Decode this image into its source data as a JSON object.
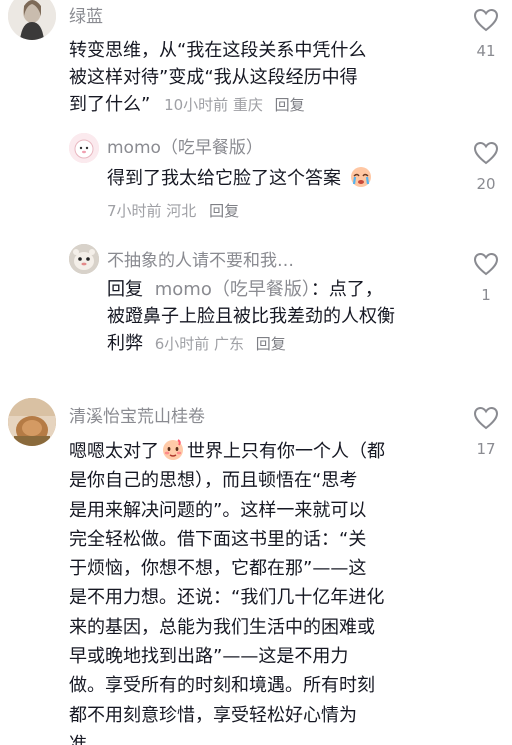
{
  "comments": [
    {
      "author": "绿蓝",
      "lines": [
        "转变思维，从“我在这段关系中凭什么",
        "被这样对待”变成“我从这段经历中得",
        "到了什么”"
      ],
      "meta": "10小时前 重庆",
      "reply_label": "回复",
      "likes": "41",
      "replies": [
        {
          "author": "momo（吃早餐版）",
          "text": "得到了我太给它脸了这个答案",
          "meta": "7小时前 河北",
          "reply_label": "回复",
          "likes": "20"
        },
        {
          "author": "不抽象的人请不要和我…",
          "prefix": "回复",
          "reply_to": "momo（吃早餐版）",
          "line1_rest": "：点了，",
          "line2": "被蹬鼻子上脸且被比我差劲的人权衡",
          "line3": "利弊",
          "meta": "6小时前 广东",
          "reply_label": "回复",
          "likes": "1"
        }
      ]
    },
    {
      "author": "清溪怡宝荒山桂卷",
      "line1_before": "嗯嗯太对了",
      "line1_after": "世界上只有你一个人（都",
      "lines": [
        "是你自己的思想），而且顿悟在“思考",
        "是用来解决问题的”。这样一来就可以",
        "完全轻松做。借下面这书里的话：“关",
        "于烦恼，你想不想，它都在那”——这",
        "是不用力想。还说：“我们几十亿年进化",
        "来的基因，总能为我们生活中的困难或",
        "早或晚地找到出路”——这是不用力",
        "做。享受所有的时刻和境遇。所有时刻",
        "都不用刻意珍惜，享受轻松好心情为",
        "准。"
      ],
      "likes": "17"
    }
  ],
  "icons": {
    "like": "heart-outline-icon",
    "emoji_sob": "crying-emoji-icon",
    "emoji_blush": "blushing-emoji-icon"
  }
}
